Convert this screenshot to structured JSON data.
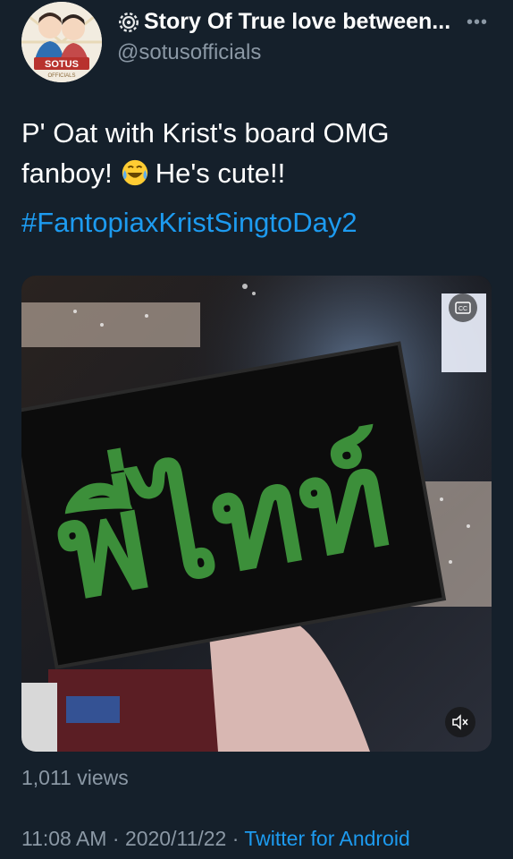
{
  "author": {
    "name": "Story Of True love between...",
    "handle": "@sotusofficials",
    "avatar_logo_text": "SOTUS",
    "avatar_sub_text": "OFFICIALS"
  },
  "tweet": {
    "text_line1": "P' Oat with Krist's board OMG",
    "text_line2_before": "fanboy!",
    "text_line2_after": "He's cute!!",
    "emoji": "face-with-tears-of-joy",
    "hashtag": "#FantopiaxKristSingtoDay2"
  },
  "media": {
    "type": "video",
    "board_text": "พี่ไทท์",
    "cc_icon": "closed-captions-icon",
    "mute_icon": "volume-muted-icon"
  },
  "stats": {
    "views": "1,011 views"
  },
  "meta": {
    "time": "11:08 AM",
    "separator": "·",
    "date": "2020/11/22",
    "source": "Twitter for Android"
  },
  "colors": {
    "background": "#15202b",
    "link": "#1d9bf0",
    "secondary_text": "#8b98a5"
  }
}
